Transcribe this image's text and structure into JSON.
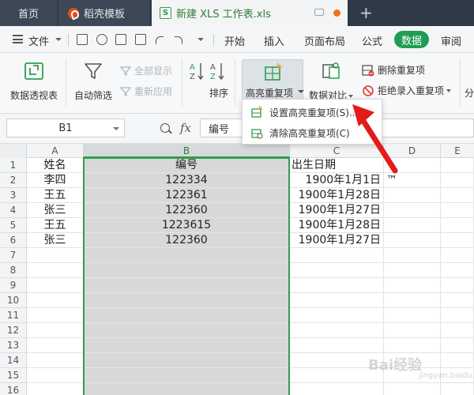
{
  "titlebar": {
    "tabs": [
      {
        "label": "首页"
      },
      {
        "label": "稻壳模板"
      },
      {
        "label": "新建 XLS 工作表.xls",
        "icon": "S"
      }
    ],
    "new_tab": "+"
  },
  "menubar": {
    "file_label": "文件",
    "tabs": [
      "开始",
      "插入",
      "页面布局",
      "公式",
      "数据",
      "审阅"
    ],
    "active_tab": "数据",
    "accent_color": "#1f9d55"
  },
  "ribbon": {
    "pivot": "数据透视表",
    "autofilter": "自动筛选",
    "show_all": "全部显示",
    "reapply": "重新应用",
    "sort": "排序",
    "highlight_dup": "高亮重复项",
    "data_compare": "数据对比",
    "remove_dup": "删除重复项",
    "reject_dup": "拒绝录入重复项",
    "split": "分"
  },
  "dropdown": {
    "items": [
      {
        "label": "设置高亮重复项(S)..."
      },
      {
        "label": "清除高亮重复项(C)"
      }
    ]
  },
  "formula_bar": {
    "cell_ref": "B1",
    "fx": "fx",
    "content": "编号"
  },
  "sheet": {
    "columns": [
      "A",
      "B",
      "C",
      "D",
      "E"
    ],
    "rows": [
      "1",
      "2",
      "3",
      "4",
      "5",
      "6",
      "7",
      "8",
      "9",
      "10",
      "11",
      "12",
      "13",
      "14",
      "15",
      "16"
    ],
    "data": [
      {
        "a": "姓名",
        "b": "编号",
        "c": "出生日期"
      },
      {
        "a": "李四",
        "b": "122334",
        "c": "1900年1月1日"
      },
      {
        "a": "王五",
        "b": "122361",
        "c": "1900年1月28日"
      },
      {
        "a": "张三",
        "b": "122360",
        "c": "1900年1月27日"
      },
      {
        "a": "王五",
        "b": "1223615",
        "c": "1900年1月28日"
      },
      {
        "a": "张三",
        "b": "122360",
        "c": "1900年1月27日"
      }
    ],
    "d2_text": "™"
  },
  "watermark": {
    "text": "Bai经验",
    "sub": "jingyan.baidu.com"
  }
}
